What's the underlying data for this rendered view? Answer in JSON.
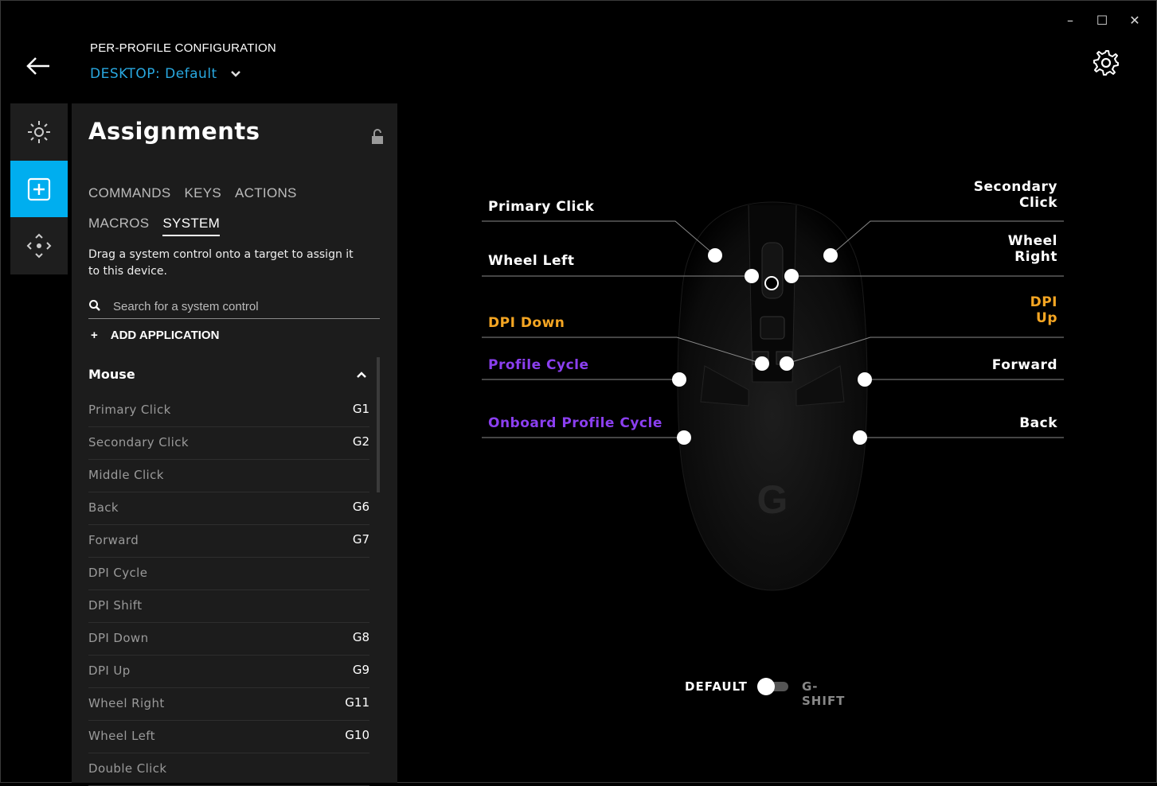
{
  "window": {
    "minimize_glyph": "–",
    "maximize_glyph": "☐",
    "close_glyph": "✕"
  },
  "header": {
    "title": "PER-PROFILE CONFIGURATION",
    "profile_label": "DESKTOP:",
    "profile_value": "Default"
  },
  "rail": {
    "items": [
      "lighting-icon",
      "assignments-icon",
      "dpi-icon"
    ],
    "active": "assignments-icon"
  },
  "panel": {
    "title": "Assignments",
    "tabs": [
      "COMMANDS",
      "KEYS",
      "ACTIONS",
      "MACROS",
      "SYSTEM"
    ],
    "active_tab": "SYSTEM",
    "help": "Drag a system control onto a target to assign it to this device.",
    "search_placeholder": "Search for a system control",
    "add_application": "ADD APPLICATION",
    "section": "Mouse",
    "rows": [
      {
        "label": "Primary Click",
        "key": "G1"
      },
      {
        "label": "Secondary Click",
        "key": "G2"
      },
      {
        "label": "Middle Click",
        "key": ""
      },
      {
        "label": "Back",
        "key": "G6"
      },
      {
        "label": "Forward",
        "key": "G7"
      },
      {
        "label": "DPI Cycle",
        "key": ""
      },
      {
        "label": "DPI Shift",
        "key": ""
      },
      {
        "label": "DPI Down",
        "key": "G8"
      },
      {
        "label": "DPI Up",
        "key": "G9"
      },
      {
        "label": "Wheel Right",
        "key": "G11"
      },
      {
        "label": "Wheel Left",
        "key": "G10"
      },
      {
        "label": "Double Click",
        "key": ""
      }
    ]
  },
  "callouts": {
    "primary_click": "Primary Click",
    "secondary_click_1": "Secondary",
    "secondary_click_2": "Click",
    "wheel_left": "Wheel Left",
    "wheel_right_1": "Wheel",
    "wheel_right_2": "Right",
    "dpi_down": "DPI Down",
    "dpi_up_1": "DPI",
    "dpi_up_2": "Up",
    "profile_cycle": "Profile Cycle",
    "forward": "Forward",
    "onboard_profile_cycle": "Onboard Profile Cycle",
    "back": "Back"
  },
  "toggle": {
    "default_label": "DEFAULT",
    "gshift_label": "G-SHIFT"
  },
  "colors": {
    "accent": "#00aeef",
    "profile_blue": "#29a8e0",
    "dpi_orange": "#f5a623",
    "profile_purple": "#8b3ff0"
  }
}
